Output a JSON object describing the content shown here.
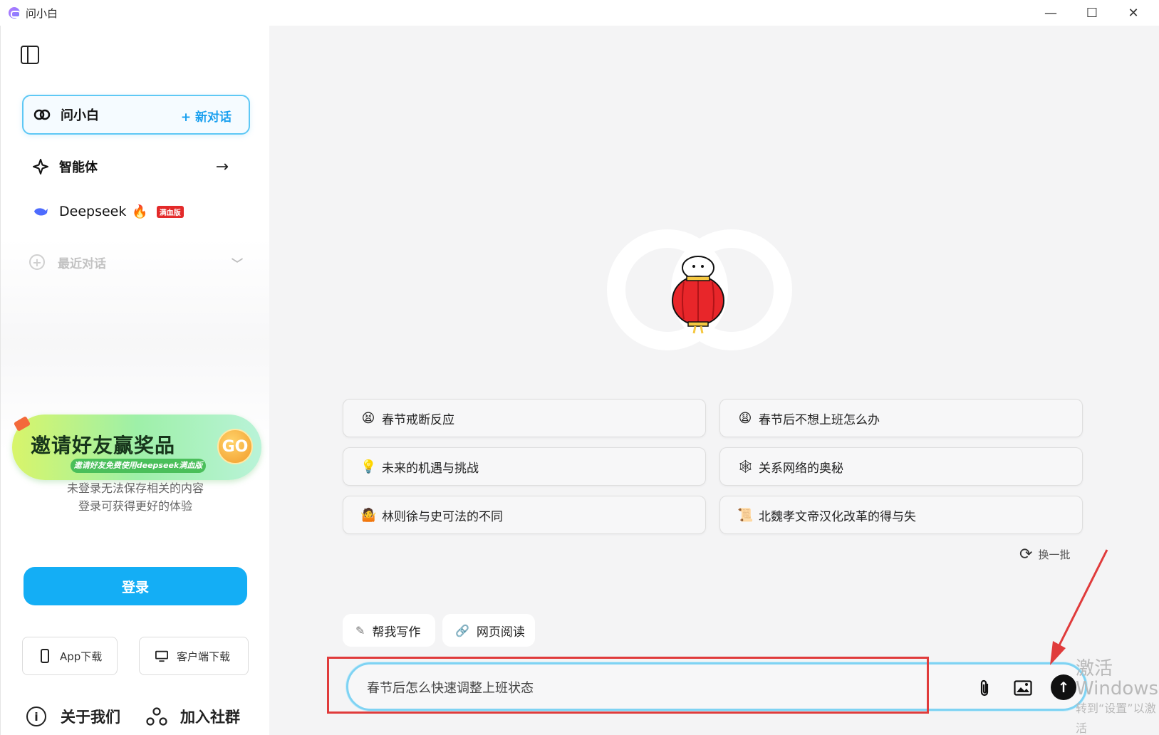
{
  "window": {
    "title": "问小白",
    "controls": {
      "minimize": "—",
      "maximize": "☐",
      "close": "✕"
    }
  },
  "sidebar": {
    "nav": [
      {
        "label": "问小白",
        "action": "+ 新对话",
        "icon": "link-rings-icon"
      },
      {
        "label": "智能体",
        "icon": "sparkle-icon"
      },
      {
        "label": "Deepseek",
        "badge": "满血版",
        "icon": "whale-icon"
      }
    ],
    "recent_label": "最近对话",
    "invite": {
      "title": "邀请好友赢奖品",
      "subtitle": "邀请好友免费使用deepseek满血版",
      "go": "GO"
    },
    "login_hint_1": "未登录无法保存相关的内容",
    "login_hint_2": "登录可获得更好的体验",
    "login_button": "登录",
    "download_app": "App下载",
    "download_client": "客户端下载",
    "about": "关于我们",
    "join": "加入社群"
  },
  "main": {
    "suggestions": [
      {
        "emoji": "😫",
        "label": "春节戒断反应"
      },
      {
        "emoji": "😩",
        "label": "春节后不想上班怎么办"
      },
      {
        "emoji": "💡",
        "label": "未来的机遇与挑战"
      },
      {
        "emoji": "🕸",
        "label": "关系网络的奥秘"
      },
      {
        "emoji": "🤷",
        "label": "林则徐与史可法的不同"
      },
      {
        "emoji": "📜",
        "label": "北魏孝文帝汉化改革的得与失"
      }
    ],
    "refresh_label": "换一批",
    "tools": [
      {
        "label": "帮我写作",
        "icon": "edit-icon"
      },
      {
        "label": "网页阅读",
        "icon": "link-icon"
      }
    ],
    "input": {
      "value": "春节后怎么快速调整上班状态"
    }
  },
  "watermark": {
    "line1": "激活 Windows",
    "line2": "转到“设置”以激活"
  },
  "colors": {
    "accent": "#14aef5",
    "highlight_box": "#e03b3b",
    "input_border": "#7fd3f3"
  }
}
